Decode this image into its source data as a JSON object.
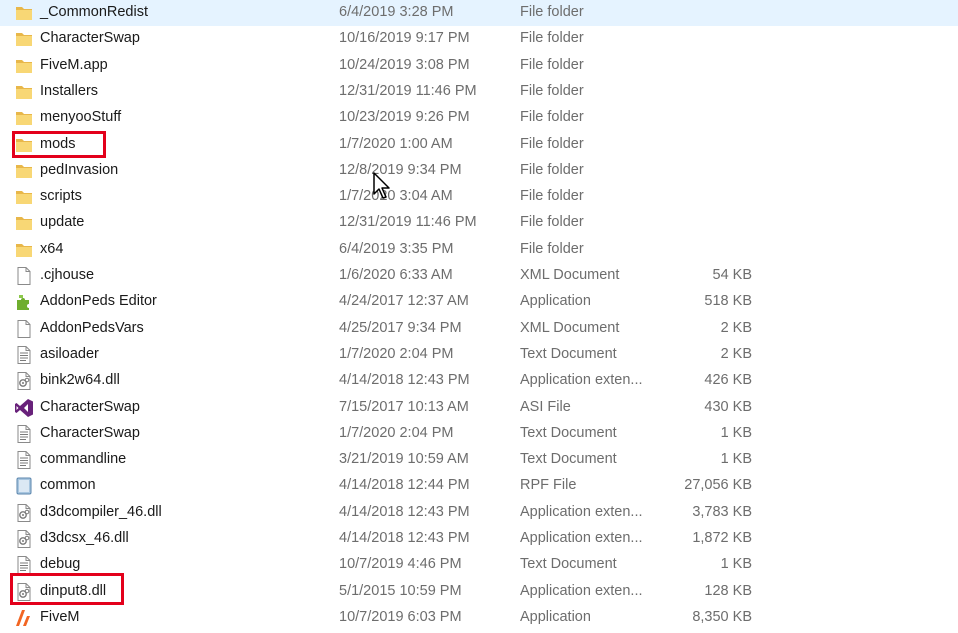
{
  "files": [
    {
      "name": "_CommonRedist",
      "date": "6/4/2019 3:28 PM",
      "type": "File folder",
      "size": "",
      "icon": "folder-icon"
    },
    {
      "name": "CharacterSwap",
      "date": "10/16/2019 9:17 PM",
      "type": "File folder",
      "size": "",
      "icon": "folder-icon"
    },
    {
      "name": "FiveM.app",
      "date": "10/24/2019 3:08 PM",
      "type": "File folder",
      "size": "",
      "icon": "folder-icon"
    },
    {
      "name": "Installers",
      "date": "12/31/2019 11:46 PM",
      "type": "File folder",
      "size": "",
      "icon": "folder-icon"
    },
    {
      "name": "menyooStuff",
      "date": "10/23/2019 9:26 PM",
      "type": "File folder",
      "size": "",
      "icon": "folder-icon"
    },
    {
      "name": "mods",
      "date": "1/7/2020 1:00 AM",
      "type": "File folder",
      "size": "",
      "icon": "folder-icon"
    },
    {
      "name": "pedInvasion",
      "date": "12/8/2019 9:34 PM",
      "type": "File folder",
      "size": "",
      "icon": "folder-icon"
    },
    {
      "name": "scripts",
      "date": "1/7/2020 3:04 AM",
      "type": "File folder",
      "size": "",
      "icon": "folder-icon"
    },
    {
      "name": "update",
      "date": "12/31/2019 11:46 PM",
      "type": "File folder",
      "size": "",
      "icon": "folder-icon"
    },
    {
      "name": "x64",
      "date": "6/4/2019 3:35 PM",
      "type": "File folder",
      "size": "",
      "icon": "folder-icon"
    },
    {
      "name": ".cjhouse",
      "date": "1/6/2020 6:33 AM",
      "type": "XML Document",
      "size": "54 KB",
      "icon": "blank-file-icon"
    },
    {
      "name": "AddonPeds Editor",
      "date": "4/24/2017 12:37 AM",
      "type": "Application",
      "size": "518 KB",
      "icon": "puzzle-app-icon"
    },
    {
      "name": "AddonPedsVars",
      "date": "4/25/2017 9:34 PM",
      "type": "XML Document",
      "size": "2 KB",
      "icon": "blank-file-icon"
    },
    {
      "name": "asiloader",
      "date": "1/7/2020 2:04 PM",
      "type": "Text Document",
      "size": "2 KB",
      "icon": "text-file-icon"
    },
    {
      "name": "bink2w64.dll",
      "date": "4/14/2018 12:43 PM",
      "type": "Application exten...",
      "size": "426 KB",
      "icon": "dll-file-icon"
    },
    {
      "name": "CharacterSwap",
      "date": "7/15/2017 10:13 AM",
      "type": "ASI File",
      "size": "430 KB",
      "icon": "visual-studio-icon"
    },
    {
      "name": "CharacterSwap",
      "date": "1/7/2020 2:04 PM",
      "type": "Text Document",
      "size": "1 KB",
      "icon": "text-file-icon"
    },
    {
      "name": "commandline",
      "date": "3/21/2019 10:59 AM",
      "type": "Text Document",
      "size": "1 KB",
      "icon": "text-file-icon"
    },
    {
      "name": "common",
      "date": "4/14/2018 12:44 PM",
      "type": "RPF File",
      "size": "27,056 KB",
      "icon": "rpf-file-icon"
    },
    {
      "name": "d3dcompiler_46.dll",
      "date": "4/14/2018 12:43 PM",
      "type": "Application exten...",
      "size": "3,783 KB",
      "icon": "dll-file-icon"
    },
    {
      "name": "d3dcsx_46.dll",
      "date": "4/14/2018 12:43 PM",
      "type": "Application exten...",
      "size": "1,872 KB",
      "icon": "dll-file-icon"
    },
    {
      "name": "debug",
      "date": "10/7/2019 4:46 PM",
      "type": "Text Document",
      "size": "1 KB",
      "icon": "text-file-icon"
    },
    {
      "name": "dinput8.dll",
      "date": "5/1/2015 10:59 PM",
      "type": "Application exten...",
      "size": "128 KB",
      "icon": "dll-file-icon"
    },
    {
      "name": "FiveM",
      "date": "10/7/2019 6:03 PM",
      "type": "Application",
      "size": "8,350 KB",
      "icon": "fivem-app-icon"
    }
  ],
  "colors": {
    "highlight": "#e3001b",
    "folder": "#f8d775",
    "folder_dark": "#e8b74a"
  }
}
